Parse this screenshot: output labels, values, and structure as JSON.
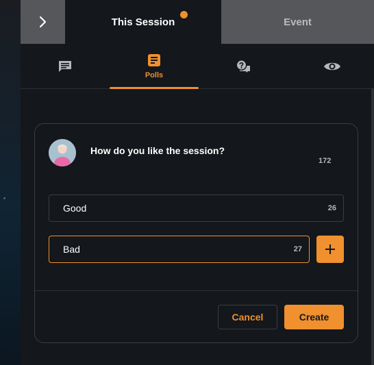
{
  "header": {
    "active_tab": "This Session",
    "inactive_tab": "Event",
    "collapse_icon": "chevron-right-icon"
  },
  "nav": {
    "items": [
      {
        "icon": "chat-icon",
        "label": ""
      },
      {
        "icon": "polls-icon",
        "label": "Polls",
        "active": true
      },
      {
        "icon": "qa-icon",
        "label": ""
      },
      {
        "icon": "eye-icon",
        "label": ""
      }
    ]
  },
  "poll": {
    "question": "How do you like the session?",
    "question_count": "172",
    "options": [
      {
        "value": "Good",
        "count": "26"
      },
      {
        "value": "Bad",
        "count": "27"
      }
    ],
    "cancel_label": "Cancel",
    "create_label": "Create"
  },
  "colors": {
    "accent": "#f0902e",
    "panel": "#14171b",
    "tab_inactive": "#55575b",
    "border": "#3a3d42"
  }
}
